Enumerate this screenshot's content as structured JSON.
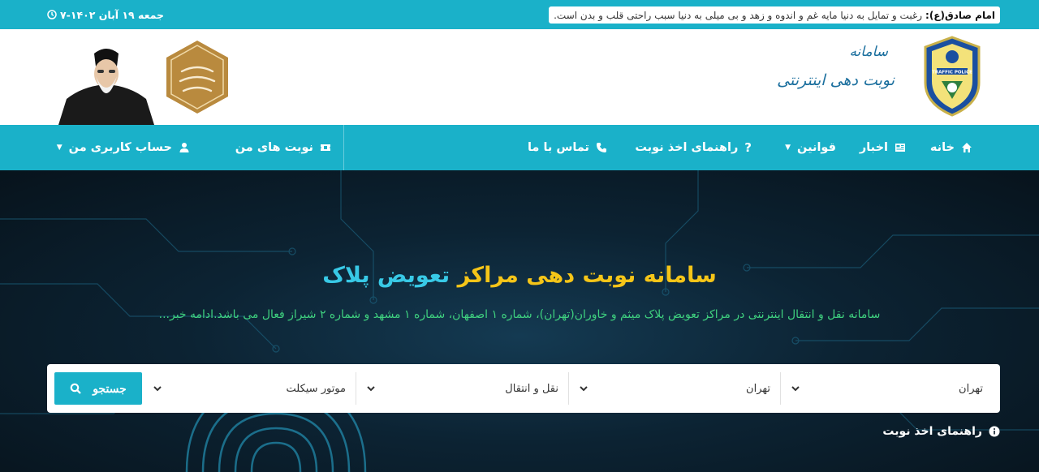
{
  "topbar": {
    "quote_label": "امام صادق(ع):",
    "quote_text": "رغبت و تمایل به دنیا مایه غم و اندوه و زهد و بی میلی به دنیا سبب راحتی قلب و بدن است.",
    "date": "جمعه ۱۹ آبان ۱۴۰۲-۷"
  },
  "header": {
    "brand_line1": "سامانه",
    "brand_line2": "نوبت دهی اینترنتی",
    "police_badge_text": "TRAFFIC POLICE"
  },
  "nav": {
    "home": "خانه",
    "news": "اخبار",
    "rules": "قوانین",
    "guide": "راهنمای اخذ نوبت",
    "contact": "تماس با ما",
    "my_appointments": "نوبت های من",
    "my_account": "حساب کاربری من"
  },
  "hero": {
    "title_part1": "سامانه نوبت دهی مراکز",
    "title_part2": "تعویض پلاک",
    "subtitle": "سامانه نقل و انتقال اینترنتی در مراکز تعویض پلاک میثم و خاوران(تهران)، شماره ۱ اصفهان، شماره ۱ مشهد و شماره ۲ شیراز فعال می باشد.",
    "more_link": "ادامه خبر..."
  },
  "search": {
    "province": "تهران",
    "city": "تهران",
    "service": "نقل و انتقال",
    "vehicle": "موتور سیکلت",
    "button_label": "جستجو"
  },
  "guide_link": "راهنمای اخذ نوبت",
  "colors": {
    "accent": "#1ab1c9",
    "title_yellow": "#f5c518",
    "title_cyan": "#38c9e6",
    "subtitle_green": "#3fd17f"
  }
}
